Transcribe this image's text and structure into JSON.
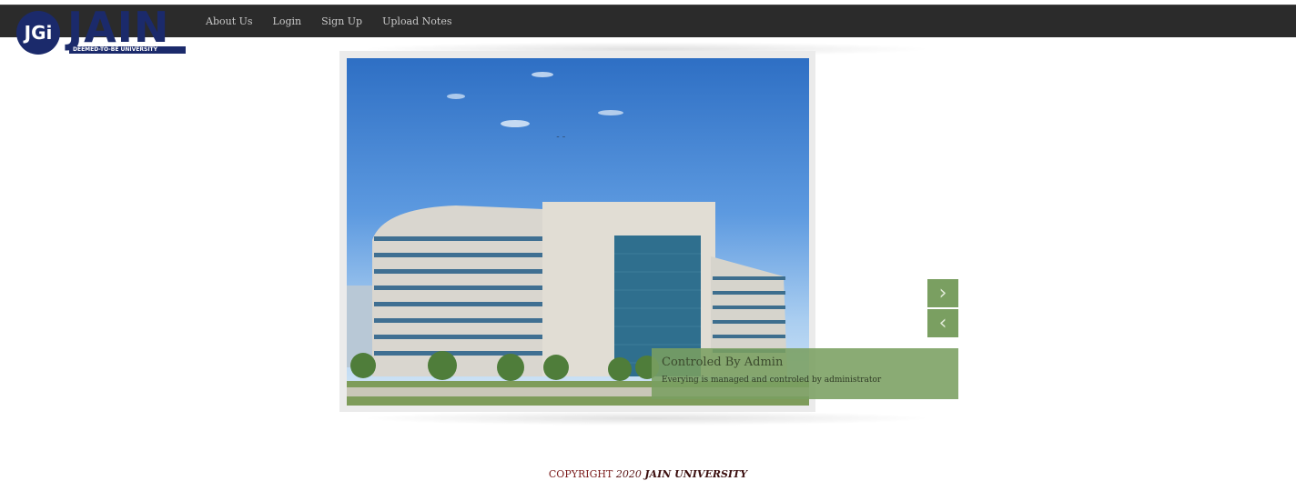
{
  "logo": {
    "badge": "JGi",
    "wordmark": "JAIN",
    "tagline": "DEEMED-TO-BE UNIVERSITY",
    "brand_color": "#1b2a6b"
  },
  "nav": {
    "items": [
      {
        "label": "About Us"
      },
      {
        "label": "Login"
      },
      {
        "label": "Sign Up"
      },
      {
        "label": "Upload Notes"
      }
    ]
  },
  "slider": {
    "image_alt": "building-photo",
    "next_icon": "chevron-right-icon",
    "prev_icon": "chevron-left-icon",
    "next_glyph": "›",
    "prev_glyph": "‹",
    "accent_color": "#7a9f61",
    "caption": {
      "title": "Controled By Admin",
      "text": "Everying is managed and controled by administrator"
    }
  },
  "footer": {
    "copyright": "COPYRIGHT",
    "year": "2020",
    "university": "JAIN UNIVERSITY"
  }
}
